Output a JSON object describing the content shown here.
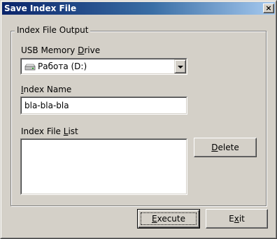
{
  "window": {
    "title": "Save Index File",
    "close_glyph": "×"
  },
  "group": {
    "label": "Index File Output"
  },
  "usb_drive": {
    "label_pre": "USB Memory ",
    "label_key": "D",
    "label_post": "rive",
    "selected_value": "Работа (D:)",
    "icon": "drive-icon"
  },
  "index_name": {
    "label_key": "I",
    "label_post": "ndex Name",
    "value": "bla-bla-bla"
  },
  "index_list": {
    "label_pre": "Index File ",
    "label_key": "L",
    "label_post": "ist",
    "items": []
  },
  "buttons": {
    "delete_key": "D",
    "delete_post": "elete",
    "execute_key": "E",
    "execute_post": "xecute",
    "exit_pre": "E",
    "exit_key": "x",
    "exit_post": "it"
  },
  "colors": {
    "face": "#d4d0c8",
    "title_start": "#0a246a",
    "title_end": "#a6caf0"
  }
}
